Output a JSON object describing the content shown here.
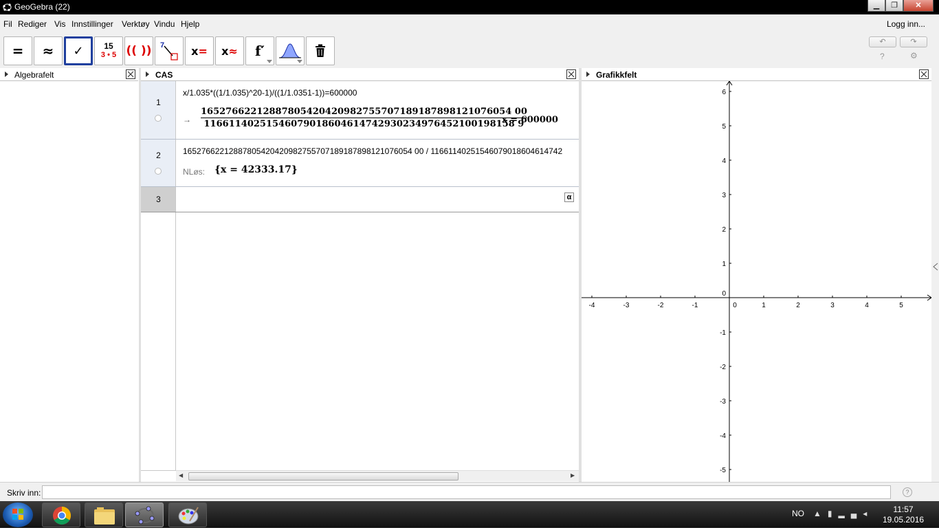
{
  "window": {
    "title": "GeoGebra (22)",
    "controls": [
      "minimize",
      "maximize",
      "close"
    ]
  },
  "menubar": {
    "items": [
      "Fil",
      "Rediger",
      "Vis",
      "Innstillinger",
      "Verktøy",
      "Vindu",
      "Hjelp"
    ],
    "login": "Logg inn..."
  },
  "toolbar": {
    "tools": [
      {
        "name": "evaluate",
        "glyph": "="
      },
      {
        "name": "numeric",
        "glyph": "≈"
      },
      {
        "name": "keep-input",
        "glyph": "✓",
        "selected": true
      },
      {
        "name": "factor",
        "glyph_top": "15",
        "glyph_bottom": "3 • 5"
      },
      {
        "name": "expand",
        "glyph": "(( ))"
      },
      {
        "name": "substitute",
        "glyph": "7"
      },
      {
        "name": "solve",
        "glyph": "x="
      },
      {
        "name": "solve-numerically",
        "glyph": "x≈"
      },
      {
        "name": "derivative",
        "glyph": "f′"
      },
      {
        "name": "probability",
        "glyph": ""
      },
      {
        "name": "delete",
        "glyph": ""
      }
    ],
    "undo": "↶",
    "redo": "↷",
    "help": "?",
    "settings": "⚙"
  },
  "panels": {
    "algebra": {
      "title": "Algebrafelt"
    },
    "cas": {
      "title": "CAS"
    },
    "graphics": {
      "title": "Grafikkfelt"
    }
  },
  "cas": {
    "rows": [
      {
        "number": "1",
        "input": "x/1.035*((1/1.035)^20-1)/((1/1.0351-1))=600000",
        "output_arrow": "→",
        "numerator": "16527662212887805420420982755707189187898121076054 00",
        "denominator": "11661140251546079018604614742930234976452100198158 9",
        "output_rhs": "x = 600000"
      },
      {
        "number": "2",
        "input": "16527662212887805420420982755707189187898121076054 00 / 11661140251546079018604614742",
        "output_label": "NLøs:",
        "output": "{x = 42333.17}"
      },
      {
        "number": "3",
        "input": "",
        "alpha_button": "α"
      }
    ]
  },
  "graphics": {
    "x_ticks": [
      "-4",
      "-3",
      "-2",
      "-1",
      "0",
      "1",
      "2",
      "3",
      "4",
      "5"
    ],
    "y_ticks": [
      "6",
      "5",
      "4",
      "3",
      "2",
      "1",
      "0",
      "-1",
      "-2",
      "-3",
      "-4",
      "-5"
    ]
  },
  "inputbar": {
    "label": "Skriv inn:",
    "value": "",
    "help": "?"
  },
  "taskbar": {
    "language": "NO",
    "time": "11:57",
    "date": "19.05.2016"
  }
}
